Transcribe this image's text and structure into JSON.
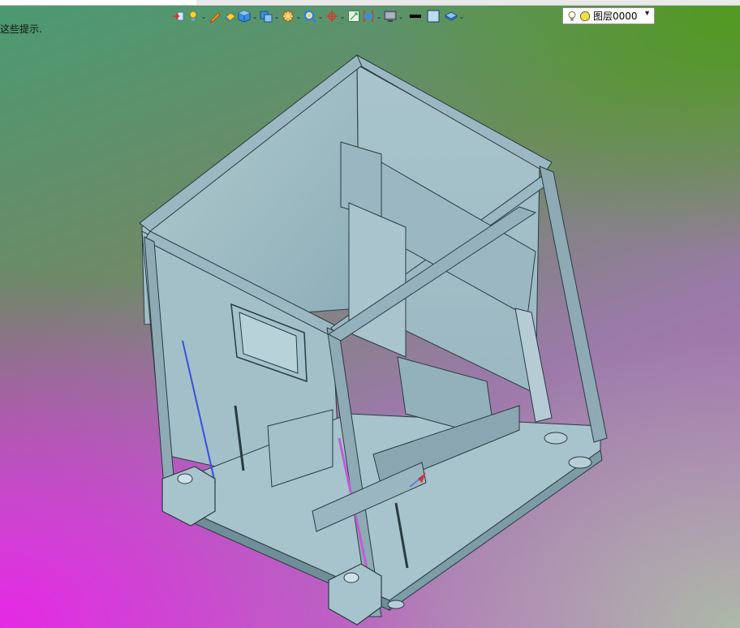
{
  "window": {
    "hint_text": "这些提示."
  },
  "toolbar": {
    "buttons": [
      {
        "name": "move-tool",
        "icon": "red-arrow-icon"
      },
      {
        "name": "light-tool",
        "icon": "lightbulb-icon",
        "dropdown": true
      },
      {
        "name": "pencil-tool",
        "icon": "pencil-icon"
      },
      {
        "name": "eraser-tool",
        "icon": "eraser-icon"
      },
      {
        "name": "solid-view-tool",
        "icon": "cube-icon",
        "dropdown": true
      },
      {
        "name": "views-tool",
        "icon": "multi-view-icon",
        "dropdown": true
      },
      {
        "name": "render-tool",
        "icon": "sun-icon",
        "dropdown": true
      },
      {
        "name": "zoom-tool",
        "icon": "magnifier-icon",
        "dropdown": true
      },
      {
        "name": "origin-tool",
        "icon": "crosshair-icon",
        "dropdown": true
      },
      {
        "name": "fit-tool",
        "icon": "fit-frame-icon"
      },
      {
        "name": "section-tool",
        "icon": "section-icon",
        "dropdown": true
      },
      {
        "name": "display-tool",
        "icon": "monitor-icon",
        "dropdown": true
      },
      {
        "name": "line-weight-tool",
        "icon": "line-weight-icon"
      },
      {
        "name": "color-tool",
        "icon": "color-swatch-icon"
      },
      {
        "name": "layers-tool",
        "icon": "layers-icon",
        "dropdown": true
      }
    ],
    "layer": {
      "label": "图层0000",
      "icon_bulb": "lightbulb-icon",
      "icon_status": "yellow-circle-icon"
    }
  },
  "colors": {
    "model_fill": "#a9c6cf",
    "model_dark": "#6f8e98",
    "model_line": "#2a3a40",
    "accent_blue": "#3a4fd8",
    "accent_purple": "#c35cd6",
    "tb_icon_blue": "#2f7fd0",
    "tb_icon_red": "#d23a2a",
    "tb_icon_orange": "#f39a1d",
    "tb_icon_yellow": "#f6d23a"
  }
}
